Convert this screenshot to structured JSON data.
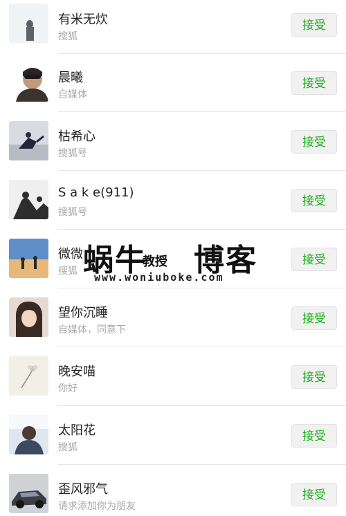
{
  "requests": [
    {
      "name": "有米无炊",
      "sub": "搜狐",
      "button": "接受",
      "avatar": "avatar-foggy-figure"
    },
    {
      "name": "晨曦",
      "sub": "自媒体",
      "button": "接受",
      "avatar": "avatar-man-sunglasses"
    },
    {
      "name": "枯希心",
      "sub": "搜狐号",
      "button": "接受",
      "avatar": "avatar-jumping-figure"
    },
    {
      "name": "S a k e(911)",
      "sub": "搜狐号",
      "button": "接受",
      "avatar": "avatar-couple-silhouette"
    },
    {
      "name": "微微",
      "sub": "搜狐",
      "button": "接受",
      "avatar": "avatar-beach-figures"
    },
    {
      "name": "望你沉睡",
      "sub": "自媒体，同意下",
      "button": "接受",
      "avatar": "avatar-girl-portrait"
    },
    {
      "name": "晚安喵",
      "sub": "你好",
      "button": "接受",
      "avatar": "avatar-flower-sketch"
    },
    {
      "name": "太阳花",
      "sub": "搜狐",
      "button": "接受",
      "avatar": "avatar-boy-light"
    },
    {
      "name": "歪风邪气",
      "sub": "请求添加你为朋友",
      "button": "接受",
      "avatar": "avatar-sports-car"
    }
  ],
  "watermark": {
    "brand_a": "蜗牛",
    "brand_b": "教授",
    "brand_c": "博客",
    "url": "www.woniuboke.com"
  }
}
